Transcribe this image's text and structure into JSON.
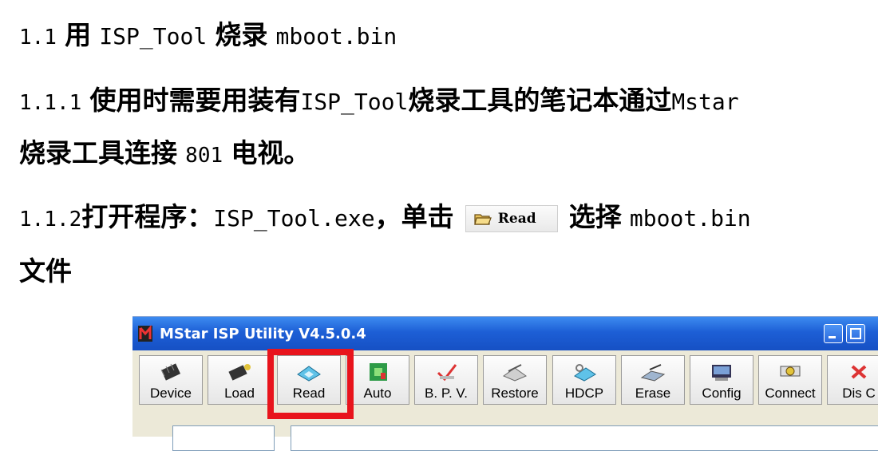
{
  "doc": {
    "heading": {
      "prefix": "1.1",
      "word": "用",
      "mono1": "ISP_Tool",
      "word2": "烧录",
      "mono2": "mboot.bin"
    },
    "step1": {
      "num": "1.1.1",
      "text_a": "使用时需要用装有",
      "mono": "ISP_Tool",
      "text_b": "烧录工具的笔记本通过",
      "mono2": "Mstar",
      "line2_a": "烧录工具连接",
      "line2_num": "801",
      "line2_b": "电视。"
    },
    "step2": {
      "num": "1.1.2",
      "text_a": "打开程序：",
      "mono": "ISP_Tool.exe",
      "text_b": "，单击",
      "button_label": "Read",
      "text_c": "选择",
      "mono2": "mboot.bin",
      "line2": "文件"
    }
  },
  "window": {
    "title": "MStar ISP Utility V4.5.0.4",
    "toolbar": [
      {
        "label": "Device",
        "icon": "chip-icon"
      },
      {
        "label": "Load",
        "icon": "chip-load-icon"
      },
      {
        "label": "Read",
        "icon": "read-disk-icon"
      },
      {
        "label": "Auto",
        "icon": "auto-icon"
      },
      {
        "label": "B. P. V.",
        "icon": "check-icon"
      },
      {
        "label": "Restore",
        "icon": "restore-icon"
      },
      {
        "label": "HDCP",
        "icon": "hdcp-key-icon"
      },
      {
        "label": "Erase",
        "icon": "erase-icon"
      },
      {
        "label": "Config",
        "icon": "config-icon"
      },
      {
        "label": "Connect",
        "icon": "connect-icon"
      },
      {
        "label": "Dis C",
        "icon": "disconnect-icon"
      }
    ]
  },
  "colors": {
    "highlight": "#e8141c",
    "titlebar": "#1d5fd6"
  }
}
